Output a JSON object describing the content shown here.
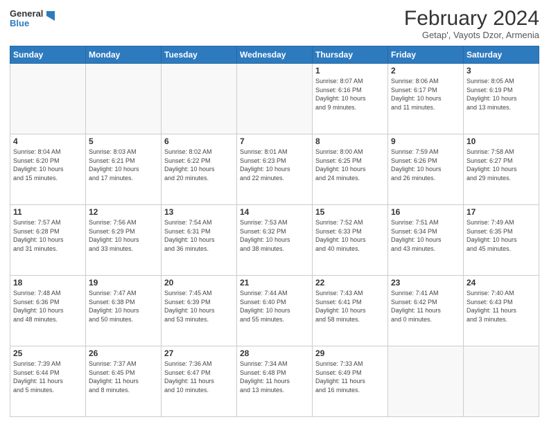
{
  "header": {
    "logo_line1": "General",
    "logo_line2": "Blue",
    "title": "February 2024",
    "subtitle": "Getap', Vayots Dzor, Armenia"
  },
  "days_of_week": [
    "Sunday",
    "Monday",
    "Tuesday",
    "Wednesday",
    "Thursday",
    "Friday",
    "Saturday"
  ],
  "weeks": [
    [
      {
        "day": "",
        "info": ""
      },
      {
        "day": "",
        "info": ""
      },
      {
        "day": "",
        "info": ""
      },
      {
        "day": "",
        "info": ""
      },
      {
        "day": "1",
        "info": "Sunrise: 8:07 AM\nSunset: 6:16 PM\nDaylight: 10 hours\nand 9 minutes."
      },
      {
        "day": "2",
        "info": "Sunrise: 8:06 AM\nSunset: 6:17 PM\nDaylight: 10 hours\nand 11 minutes."
      },
      {
        "day": "3",
        "info": "Sunrise: 8:05 AM\nSunset: 6:19 PM\nDaylight: 10 hours\nand 13 minutes."
      }
    ],
    [
      {
        "day": "4",
        "info": "Sunrise: 8:04 AM\nSunset: 6:20 PM\nDaylight: 10 hours\nand 15 minutes."
      },
      {
        "day": "5",
        "info": "Sunrise: 8:03 AM\nSunset: 6:21 PM\nDaylight: 10 hours\nand 17 minutes."
      },
      {
        "day": "6",
        "info": "Sunrise: 8:02 AM\nSunset: 6:22 PM\nDaylight: 10 hours\nand 20 minutes."
      },
      {
        "day": "7",
        "info": "Sunrise: 8:01 AM\nSunset: 6:23 PM\nDaylight: 10 hours\nand 22 minutes."
      },
      {
        "day": "8",
        "info": "Sunrise: 8:00 AM\nSunset: 6:25 PM\nDaylight: 10 hours\nand 24 minutes."
      },
      {
        "day": "9",
        "info": "Sunrise: 7:59 AM\nSunset: 6:26 PM\nDaylight: 10 hours\nand 26 minutes."
      },
      {
        "day": "10",
        "info": "Sunrise: 7:58 AM\nSunset: 6:27 PM\nDaylight: 10 hours\nand 29 minutes."
      }
    ],
    [
      {
        "day": "11",
        "info": "Sunrise: 7:57 AM\nSunset: 6:28 PM\nDaylight: 10 hours\nand 31 minutes."
      },
      {
        "day": "12",
        "info": "Sunrise: 7:56 AM\nSunset: 6:29 PM\nDaylight: 10 hours\nand 33 minutes."
      },
      {
        "day": "13",
        "info": "Sunrise: 7:54 AM\nSunset: 6:31 PM\nDaylight: 10 hours\nand 36 minutes."
      },
      {
        "day": "14",
        "info": "Sunrise: 7:53 AM\nSunset: 6:32 PM\nDaylight: 10 hours\nand 38 minutes."
      },
      {
        "day": "15",
        "info": "Sunrise: 7:52 AM\nSunset: 6:33 PM\nDaylight: 10 hours\nand 40 minutes."
      },
      {
        "day": "16",
        "info": "Sunrise: 7:51 AM\nSunset: 6:34 PM\nDaylight: 10 hours\nand 43 minutes."
      },
      {
        "day": "17",
        "info": "Sunrise: 7:49 AM\nSunset: 6:35 PM\nDaylight: 10 hours\nand 45 minutes."
      }
    ],
    [
      {
        "day": "18",
        "info": "Sunrise: 7:48 AM\nSunset: 6:36 PM\nDaylight: 10 hours\nand 48 minutes."
      },
      {
        "day": "19",
        "info": "Sunrise: 7:47 AM\nSunset: 6:38 PM\nDaylight: 10 hours\nand 50 minutes."
      },
      {
        "day": "20",
        "info": "Sunrise: 7:45 AM\nSunset: 6:39 PM\nDaylight: 10 hours\nand 53 minutes."
      },
      {
        "day": "21",
        "info": "Sunrise: 7:44 AM\nSunset: 6:40 PM\nDaylight: 10 hours\nand 55 minutes."
      },
      {
        "day": "22",
        "info": "Sunrise: 7:43 AM\nSunset: 6:41 PM\nDaylight: 10 hours\nand 58 minutes."
      },
      {
        "day": "23",
        "info": "Sunrise: 7:41 AM\nSunset: 6:42 PM\nDaylight: 11 hours\nand 0 minutes."
      },
      {
        "day": "24",
        "info": "Sunrise: 7:40 AM\nSunset: 6:43 PM\nDaylight: 11 hours\nand 3 minutes."
      }
    ],
    [
      {
        "day": "25",
        "info": "Sunrise: 7:39 AM\nSunset: 6:44 PM\nDaylight: 11 hours\nand 5 minutes."
      },
      {
        "day": "26",
        "info": "Sunrise: 7:37 AM\nSunset: 6:45 PM\nDaylight: 11 hours\nand 8 minutes."
      },
      {
        "day": "27",
        "info": "Sunrise: 7:36 AM\nSunset: 6:47 PM\nDaylight: 11 hours\nand 10 minutes."
      },
      {
        "day": "28",
        "info": "Sunrise: 7:34 AM\nSunset: 6:48 PM\nDaylight: 11 hours\nand 13 minutes."
      },
      {
        "day": "29",
        "info": "Sunrise: 7:33 AM\nSunset: 6:49 PM\nDaylight: 11 hours\nand 16 minutes."
      },
      {
        "day": "",
        "info": ""
      },
      {
        "day": "",
        "info": ""
      }
    ]
  ]
}
